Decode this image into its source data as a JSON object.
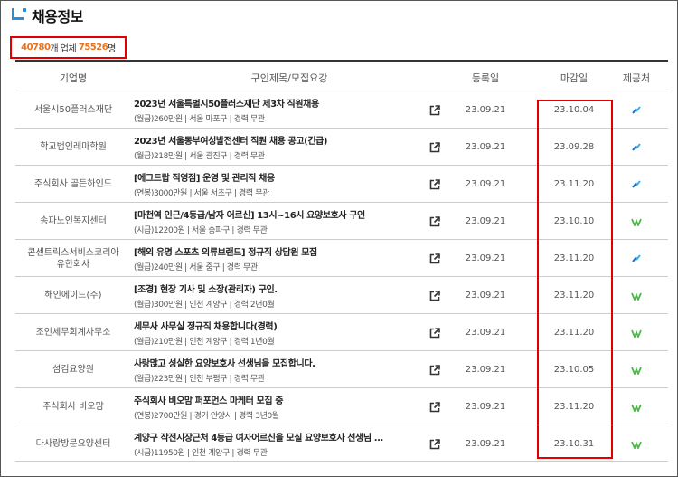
{
  "header": {
    "title": "채용정보"
  },
  "summary": {
    "company_count": "40780",
    "company_suffix": "개 업체",
    "post_count": "75526",
    "post_suffix": "명"
  },
  "columns": {
    "company": "기업명",
    "title": "구인제목/모집요강",
    "registered": "등록일",
    "deadline": "마감일",
    "provider": "제공처"
  },
  "rows": [
    {
      "company": "서울시50플러스재단",
      "title": "2023년 서울특별시50플러스재단 제3차 직원채용",
      "meta": "(월급)260만원 | 서울 마포구 | 경력 무관",
      "registered": "23.09.21",
      "deadline": "23.10.04",
      "provider": "worknet-icon"
    },
    {
      "company": "학교법인레마학원",
      "title": "2023년 서울동부여성발전센터 직원 채용 공고(긴급)",
      "meta": "(월급)218만원 | 서울 광진구 | 경력 무관",
      "registered": "23.09.21",
      "deadline": "23.09.28",
      "provider": "worknet-icon"
    },
    {
      "company": "주식회사 골든하인드",
      "title": "[에그드랍 직영점] 운영 및 관리직 채용",
      "meta": "(연봉)3000만원 | 서울 서초구 | 경력 무관",
      "registered": "23.09.21",
      "deadline": "23.11.20",
      "provider": "worknet-icon"
    },
    {
      "company": "송파노인복지센터",
      "title": "[마천역 인근/4등급/남자 어르신] 13시~16시 요양보호사 구인",
      "meta": "(시급)12200원 | 서울 송파구 | 경력 무관",
      "registered": "23.09.21",
      "deadline": "23.10.10",
      "provider": "saramin-icon"
    },
    {
      "company": "콘센트릭스서비스코리아\n유한회사",
      "title": "[해외 유명 스포츠 의류브랜드] 정규직 상담원 모집",
      "meta": "(월급)240만원 | 서울 중구 | 경력 무관",
      "registered": "23.09.21",
      "deadline": "23.11.20",
      "provider": "worknet-icon"
    },
    {
      "company": "해인에이드(주)",
      "title": "[조경] 현장 기사 및 소장(관리자) 구인.",
      "meta": "(월급)300만원 | 인천 계양구 | 경력 2년0월",
      "registered": "23.09.21",
      "deadline": "23.11.20",
      "provider": "saramin-icon"
    },
    {
      "company": "조인세무회계사무소",
      "title": "세무사 사무실 정규직 채용합니다(경력)",
      "meta": "(월급)210만원 | 인천 계양구 | 경력 1년0월",
      "registered": "23.09.21",
      "deadline": "23.11.20",
      "provider": "saramin-icon"
    },
    {
      "company": "섬김요양원",
      "title": "사랑많고 성실한 요양보호사 선생님을 모집합니다.",
      "meta": "(월급)223만원 | 인천 부평구 | 경력 무관",
      "registered": "23.09.21",
      "deadline": "23.10.05",
      "provider": "saramin-icon"
    },
    {
      "company": "주식회사 비오맘",
      "title": "주식회사 비오맘 퍼포먼스 마케터 모집 중",
      "meta": "(연봉)2700만원 | 경기 안양시 | 경력 3년0월",
      "registered": "23.09.21",
      "deadline": "23.11.20",
      "provider": "saramin-icon"
    },
    {
      "company": "다사랑방문요양센터",
      "title": "계양구 작전시장근처 4등급 여자어르신을 모실 요양보호사 선생님 ...",
      "meta": "(시급)11950원 | 인천 계양구 | 경력 무관",
      "registered": "23.09.21",
      "deadline": "23.10.31",
      "provider": "saramin-icon"
    }
  ]
}
